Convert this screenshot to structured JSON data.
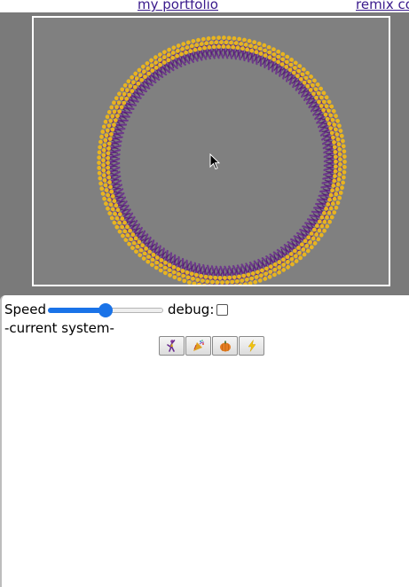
{
  "header": {
    "links": [
      {
        "label": "my portfolio"
      },
      {
        "label": "remix co"
      }
    ]
  },
  "controls": {
    "speed_label": "Speed",
    "speed_value_percent": 50,
    "debug_label": "debug:",
    "debug_checked": false
  },
  "system": {
    "label": "-current system-",
    "buttons": [
      {
        "icon": "dancer-icon"
      },
      {
        "icon": "party-popper-icon"
      },
      {
        "icon": "pumpkin-icon"
      },
      {
        "icon": "lightning-icon"
      }
    ]
  },
  "colors": {
    "ring_purple": "#6a2c8e",
    "ring_gold": "#e8b420",
    "stage_bg": "#808080",
    "accent": "#1a73e8"
  }
}
